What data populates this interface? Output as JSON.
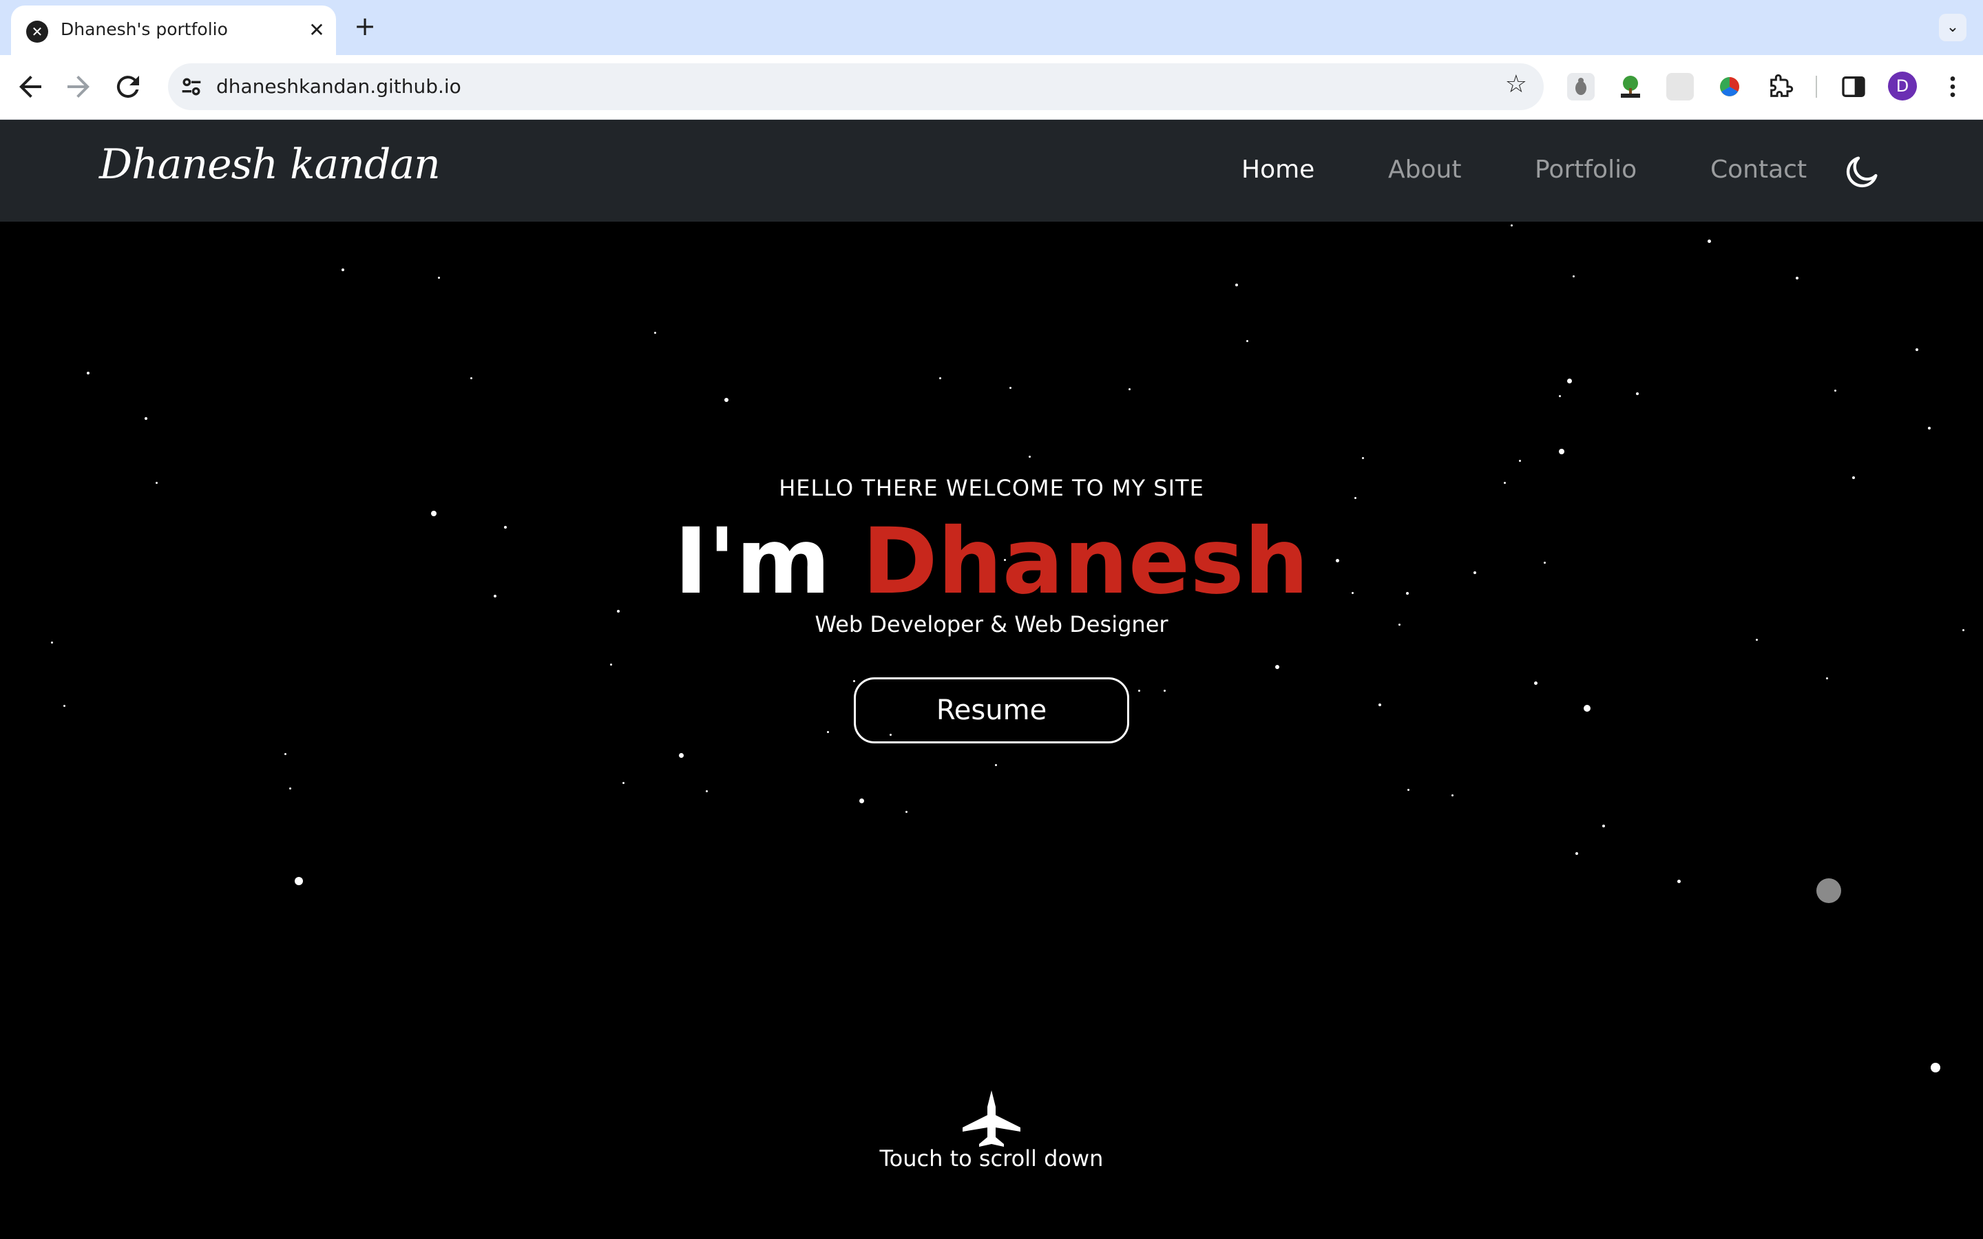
{
  "browser": {
    "tab_title": "Dhanesh's portfolio",
    "tab_close": "✕",
    "new_tab": "+",
    "tab_search": "⌄",
    "url": "dhaneshkandan.github.io",
    "profile_initial": "D",
    "icons": [
      "back-icon",
      "forward-icon",
      "reload-icon",
      "site-info-icon",
      "bookmark-star-icon",
      "extensions-icon",
      "side-panel-icon",
      "more-menu-icon"
    ]
  },
  "site": {
    "brand": "Dhanesh kandan",
    "nav": {
      "home": "Home",
      "about": "About",
      "portfolio": "Portfolio",
      "contact": "Contact"
    },
    "hero": {
      "greeting": "HELLO THERE WELCOME TO MY SITE",
      "headline_prefix": "I'm",
      "headline_name": "Dhanesh",
      "subtitle": "Web Developer & Web Designer",
      "resume_label": "Resume",
      "scroll_label": "Touch to scroll down"
    },
    "colors": {
      "navbar_bg": "#212529",
      "hero_bg": "#000000",
      "accent": "#c8271c",
      "text": "#ffffff"
    }
  }
}
